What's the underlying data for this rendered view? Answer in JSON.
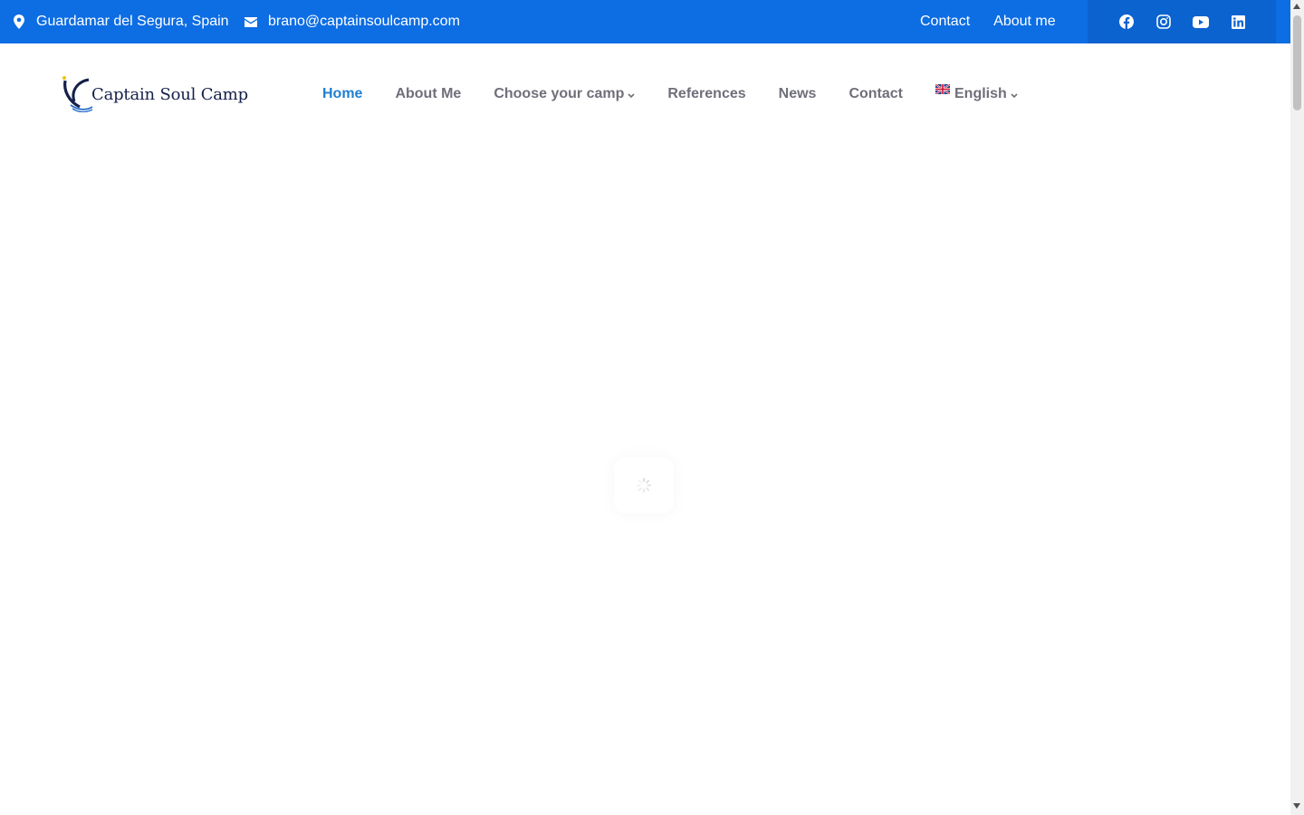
{
  "topbar": {
    "location": "Guardamar del Segura, Spain",
    "email": "brano@captainsoulcamp.com",
    "links": [
      "Contact",
      "About me"
    ],
    "social": [
      "facebook-icon",
      "instagram-icon",
      "youtube-icon",
      "linkedin-icon"
    ]
  },
  "header": {
    "logo_text": "Captain Soul Camp",
    "nav": {
      "home": "Home",
      "about": "About Me",
      "camp": "Choose your camp",
      "references": "References",
      "news": "News",
      "contact": "Contact",
      "language": "English"
    }
  },
  "colors": {
    "topbar_bg": "#0d6de3",
    "social_bg": "#0b63cf",
    "nav_active": "#1f7fd1",
    "nav_text": "#6f6f7a",
    "logo_text": "#15204a"
  }
}
